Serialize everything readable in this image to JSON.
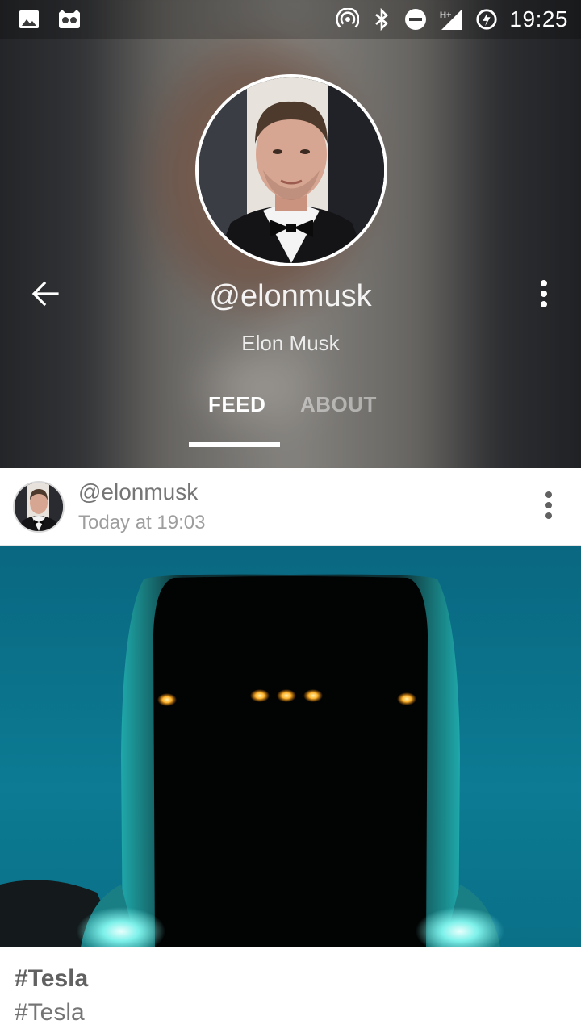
{
  "status_bar": {
    "time": "19:25",
    "left_icons": [
      "image-icon",
      "app-mascot-icon"
    ],
    "right_icons": [
      "hotspot-icon",
      "bluetooth-icon",
      "do-not-disturb-icon",
      "signal-hplus-icon",
      "battery-charging-icon"
    ],
    "network_label": "H+"
  },
  "profile": {
    "handle": "@elonmusk",
    "name": "Elon Musk"
  },
  "tabs": [
    {
      "label": "FEED",
      "active": true
    },
    {
      "label": "ABOUT",
      "active": false
    }
  ],
  "post": {
    "author": "@elonmusk",
    "time": "Today at 19:03",
    "caption_title": "#Tesla",
    "caption_text": "#Tesla"
  },
  "colors": {
    "sky": "#0b6e86",
    "accent_white": "#ffffff",
    "text_secondary": "#757575",
    "headlight_glow": "#7ef1ea",
    "marker_light": "#ffb52e"
  }
}
